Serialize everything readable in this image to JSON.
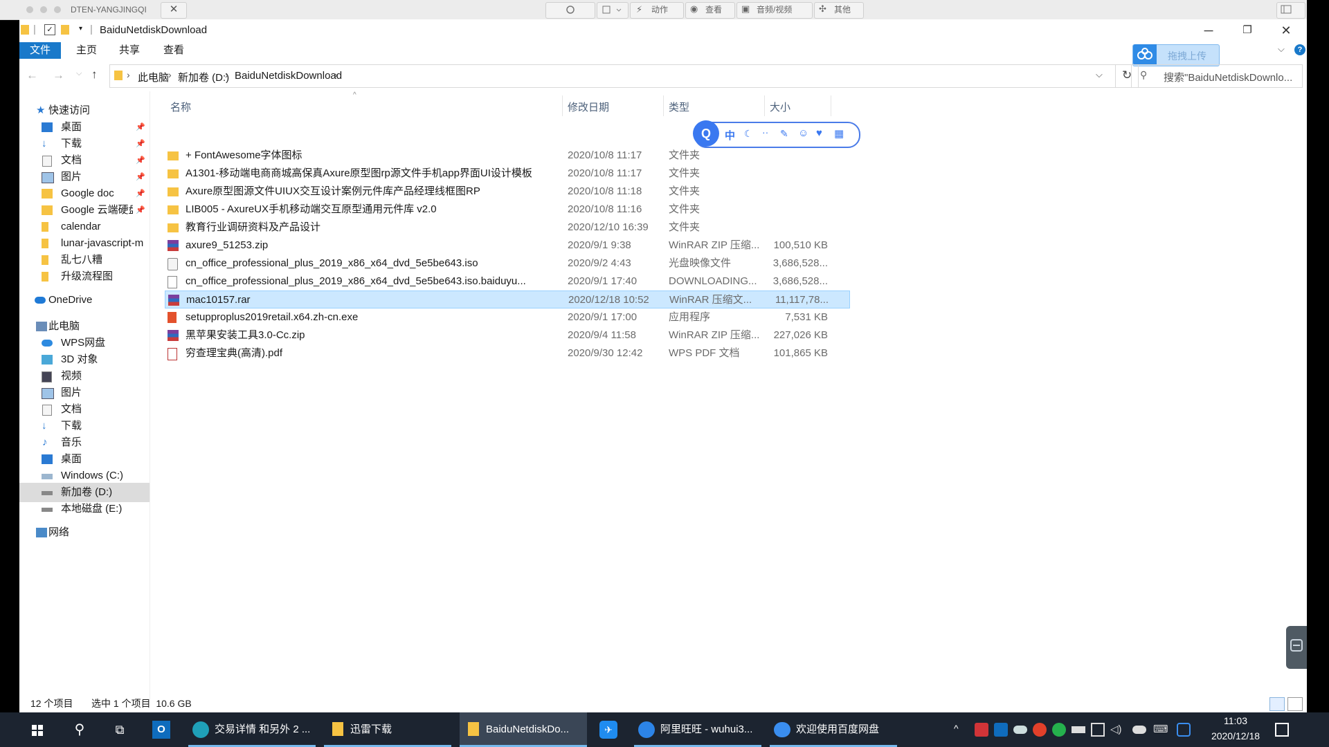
{
  "remote_bar": {
    "host": "DTEN-YANGJINGQI",
    "close": "✕",
    "menus": [
      "动作",
      "查看",
      "音频/视频",
      "其他"
    ]
  },
  "window": {
    "title": "BaiduNetdiskDownload",
    "ribbon_tabs": [
      "文件",
      "主页",
      "共享",
      "查看"
    ],
    "baidu_upload": "拖拽上传"
  },
  "address": {
    "crumbs": [
      "此电脑",
      "新加卷 (D:)",
      "BaiduNetdiskDownload"
    ],
    "search_placeholder": "搜索\"BaiduNetdiskDownlo..."
  },
  "nav": {
    "quick_access": "快速访问",
    "quick_items": [
      "桌面",
      "下载",
      "文档",
      "图片",
      "Google doc",
      "Google 云端硬盘",
      "calendar",
      "lunar-javascript-m",
      "乱七八糟",
      "升级流程图"
    ],
    "onedrive": "OneDrive",
    "this_pc": "此电脑",
    "pc_items": [
      "WPS网盘",
      "3D 对象",
      "视频",
      "图片",
      "文档",
      "下载",
      "音乐",
      "桌面",
      "Windows (C:)",
      "新加卷 (D:)",
      "本地磁盘 (E:)"
    ],
    "network": "网络"
  },
  "columns": {
    "name": "名称",
    "date": "修改日期",
    "type": "类型",
    "size": "大小"
  },
  "files": [
    {
      "name": "+ FontAwesome字体图标",
      "date": "2020/10/8 11:17",
      "type": "文件夹",
      "size": "",
      "kind": "folder"
    },
    {
      "name": "A1301-移动端电商商城高保真Axure原型图rp源文件手机app界面UI设计模板",
      "date": "2020/10/8 11:17",
      "type": "文件夹",
      "size": "",
      "kind": "folder"
    },
    {
      "name": "Axure原型图源文件UIUX交互设计案例元件库产品经理线框图RP",
      "date": "2020/10/8 11:18",
      "type": "文件夹",
      "size": "",
      "kind": "folder"
    },
    {
      "name": "LIB005 - AxureUX手机移动端交互原型通用元件库 v2.0",
      "date": "2020/10/8 11:16",
      "type": "文件夹",
      "size": "",
      "kind": "folder"
    },
    {
      "name": "教育行业调研资料及产品设计",
      "date": "2020/12/10 16:39",
      "type": "文件夹",
      "size": "",
      "kind": "folder"
    },
    {
      "name": "axure9_51253.zip",
      "date": "2020/9/1 9:38",
      "type": "WinRAR ZIP 压缩...",
      "size": "100,510 KB",
      "kind": "rar"
    },
    {
      "name": "cn_office_professional_plus_2019_x86_x64_dvd_5e5be643.iso",
      "date": "2020/9/2 4:43",
      "type": "光盘映像文件",
      "size": "3,686,528...",
      "kind": "iso"
    },
    {
      "name": "cn_office_professional_plus_2019_x86_x64_dvd_5e5be643.iso.baiduyu...",
      "date": "2020/9/1 17:40",
      "type": "DOWNLOADING...",
      "size": "3,686,528...",
      "kind": "blank"
    },
    {
      "name": "mac10157.rar",
      "date": "2020/12/18 10:52",
      "type": "WinRAR 压缩文...",
      "size": "11,117,78...",
      "kind": "rar",
      "selected": true
    },
    {
      "name": "setupproplus2019retail.x64.zh-cn.exe",
      "date": "2020/9/1 17:00",
      "type": "应用程序",
      "size": "7,531 KB",
      "kind": "office"
    },
    {
      "name": "黑苹果安装工具3.0-Cc.zip",
      "date": "2020/9/4 11:58",
      "type": "WinRAR ZIP 压缩...",
      "size": "227,026 KB",
      "kind": "rar"
    },
    {
      "name": "穷查理宝典(高清).pdf",
      "date": "2020/9/30 12:42",
      "type": "WPS PDF 文档",
      "size": "101,865 KB",
      "kind": "pdf"
    }
  ],
  "status": {
    "count": "12 个项目",
    "selection": "选中 1 个项目  10.6 GB"
  },
  "ime": {
    "mode": "中"
  },
  "taskbar": {
    "items": [
      "交易详情 和另外 2 ...",
      "迅雷下载",
      "BaiduNetdiskDo...",
      "阿里旺旺 - wuhui3...",
      "欢迎使用百度网盘"
    ],
    "time": "11:03",
    "date": "2020/12/18"
  }
}
